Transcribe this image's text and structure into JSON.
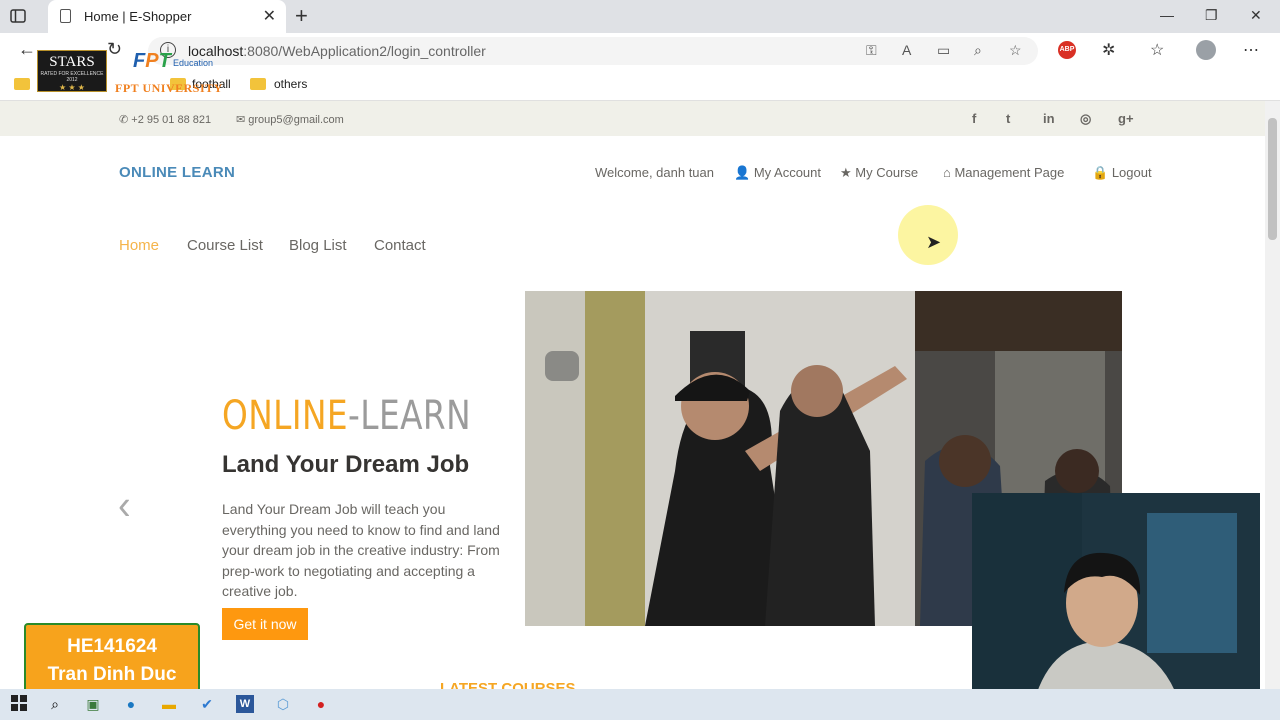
{
  "browser": {
    "tab_title": "Home | E-Shopper",
    "url_host": "localhost",
    "url_rest": ":8080/WebApplication2/login_controller",
    "bookmarks": [
      "football",
      "others"
    ]
  },
  "overlay": {
    "stars_big": "STARS",
    "stars_small": "RATED FOR EXCELLENCE",
    "stars_year": "2012",
    "fpt_mark": "FPT",
    "fpt_edu": "Education",
    "fpt_uni": "FPT UNIVERSITY",
    "student_id": "HE141624",
    "student_name": "Tran Dinh Duc"
  },
  "page": {
    "phone": "+2 95 01 88 821",
    "email": "group5@gmail.com",
    "social": [
      "f",
      "t",
      "in",
      "◎",
      "g+"
    ],
    "brand": "ONLINE LEARN",
    "welcome": "Welcome, danh tuan",
    "account_links": [
      "My Account",
      "My Course",
      "Management Page",
      "Logout"
    ],
    "menu": [
      "Home",
      "Course List",
      "Blog List",
      "Contact"
    ],
    "hero": {
      "title_a": "ONLINE",
      "title_b": "-LEARN",
      "subtitle": "Land Your Dream Job",
      "description": "Land Your Dream Job will teach you everything you need to know to find and land your dream job in the creative industry: From prep-work to negotiating and accepting a creative job.",
      "button": "Get it now"
    },
    "latest_heading": "LATEST COURSES"
  },
  "colors": {
    "accent": "#fe980f",
    "brand": "#4a8ab8",
    "topbar": "#f0f0e9"
  }
}
